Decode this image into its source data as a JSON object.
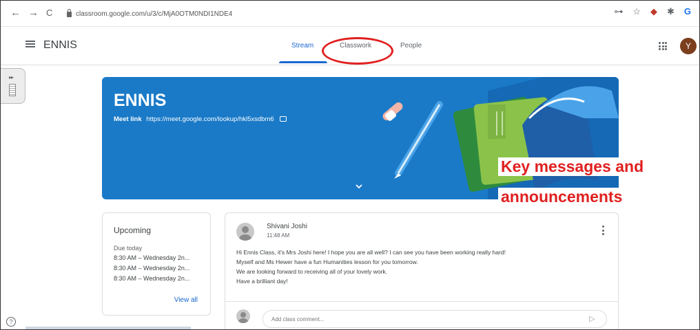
{
  "browser": {
    "url": "classroom.google.com/u/3/c/MjA0OTM0NDI1NDE4",
    "back_glyph": "←",
    "forward_glyph": "→",
    "reload_glyph": "C"
  },
  "header": {
    "class_name": "ENNIS",
    "tabs": [
      {
        "label": "Stream"
      },
      {
        "label": "Classwork"
      },
      {
        "label": "People"
      }
    ],
    "avatar_letter": "Y"
  },
  "banner": {
    "title": "ENNIS",
    "meet_label": "Meet link",
    "meet_url": "https://meet.google.com/lookup/hkl5xsdbm6",
    "color": "#1a7ac8"
  },
  "annotation": {
    "line1": "Key messages and",
    "line2": "announcements",
    "color": "#e02020"
  },
  "upcoming": {
    "title": "Upcoming",
    "due": "Due today",
    "items": [
      "8:30 AM – Wednesday 2n...",
      "8:30 AM – Wednesday 2n...",
      "8:30 AM – Wednesday 2n..."
    ],
    "view_all": "View all"
  },
  "post": {
    "author": "Shivani Joshi",
    "time": "11:48 AM",
    "lines": [
      "Hi Ennis Class, it's Mrs Joshi here! I hope you are all well? I can see you have been working really hard!",
      "Myself and Ms Hewer have a fun Humanities lesson for you tomorrow.",
      "We are looking forward to receiving all of your lovely work.",
      "Have a brilliant day!"
    ],
    "comment_placeholder": "Add class comment..."
  },
  "accent_color": "#1967d2"
}
